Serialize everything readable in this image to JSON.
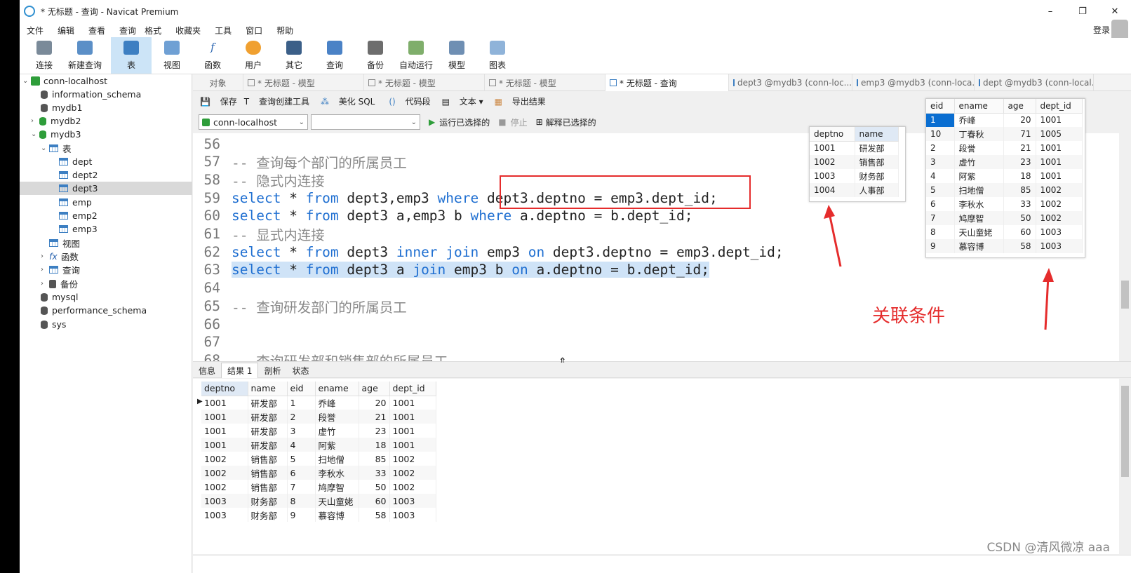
{
  "window": {
    "title": "* 无标题 - 查询 - Navicat Premium",
    "controls": [
      "–",
      "❐",
      "✕"
    ]
  },
  "menu": [
    "文件",
    "编辑",
    "查看",
    "查询",
    "格式",
    "收藏夹",
    "工具",
    "窗口",
    "帮助"
  ],
  "login_label": "登录",
  "toolbar": [
    {
      "label": "连接",
      "icon": "plug-icon"
    },
    {
      "label": "新建查询",
      "icon": "new-query-icon"
    },
    {
      "label": "表",
      "icon": "table-icon"
    },
    {
      "label": "视图",
      "icon": "view-icon"
    },
    {
      "label": "函数",
      "icon": "function-icon"
    },
    {
      "label": "用户",
      "icon": "user-icon"
    },
    {
      "label": "其它",
      "icon": "tools-icon"
    },
    {
      "label": "查询",
      "icon": "query-icon"
    },
    {
      "label": "备份",
      "icon": "backup-icon"
    },
    {
      "label": "自动运行",
      "icon": "schedule-icon"
    },
    {
      "label": "模型",
      "icon": "model-icon"
    },
    {
      "label": "图表",
      "icon": "chart-icon"
    }
  ],
  "tree": {
    "connection": "conn-localhost",
    "databases_top": [
      "information_schema",
      "mydb1",
      "mydb2",
      "mydb3"
    ],
    "tables_label": "表",
    "tables": [
      "dept",
      "dept2",
      "dept3",
      "emp",
      "emp2",
      "emp3"
    ],
    "views_label": "视图",
    "functions_label": "函数",
    "queries_label": "查询",
    "backups_label": "备份",
    "databases_bottom": [
      "mysql",
      "performance_schema",
      "sys"
    ]
  },
  "tabs": [
    "对象",
    "* 无标题 - 模型",
    "* 无标题 - 模型",
    "* 无标题 - 模型",
    "* 无标题 - 查询",
    "dept3 @mydb3 (conn-loc...",
    "emp3 @mydb3 (conn-loca...",
    "dept @mydb3 (conn-local..."
  ],
  "editor_toolbar": {
    "save": "保存",
    "query_builder": "查询创建工具",
    "beautify": "美化 SQL",
    "snippet": "代码段",
    "text": "文本",
    "export": "导出结果",
    "connection": "conn-localhost",
    "run_selected": "运行已选择的",
    "stop": "停止",
    "explain": "解释已选择的"
  },
  "code_lines": [
    {
      "n": "56",
      "parts": []
    },
    {
      "n": "57",
      "parts": [
        [
          "cm",
          "-- 查询每个部门的所属员工"
        ]
      ]
    },
    {
      "n": "58",
      "parts": [
        [
          "cm",
          "-- 隐式内连接"
        ]
      ]
    },
    {
      "n": "59",
      "parts": [
        [
          "kw",
          "select"
        ],
        [
          "t",
          " * "
        ],
        [
          "kw",
          "from"
        ],
        [
          "t",
          " dept3,emp3 "
        ],
        [
          "kw",
          "where"
        ],
        [
          "t",
          " dept3.deptno = emp3.dept_id;"
        ]
      ]
    },
    {
      "n": "60",
      "parts": [
        [
          "kw",
          "select"
        ],
        [
          "t",
          " * "
        ],
        [
          "kw",
          "from"
        ],
        [
          "t",
          " dept3 a,emp3 b "
        ],
        [
          "kw",
          "where"
        ],
        [
          "t",
          " a.deptno = b.dept_id;"
        ]
      ]
    },
    {
      "n": "61",
      "parts": [
        [
          "cm",
          "-- 显式内连接"
        ]
      ]
    },
    {
      "n": "62",
      "parts": [
        [
          "kw",
          "select"
        ],
        [
          "t",
          " * "
        ],
        [
          "kw",
          "from"
        ],
        [
          "t",
          " dept3 "
        ],
        [
          "kw",
          "inner join"
        ],
        [
          "t",
          " emp3 "
        ],
        [
          "kw",
          "on"
        ],
        [
          "t",
          " dept3.deptno = emp3.dept_id;"
        ]
      ]
    },
    {
      "n": "63",
      "parts": [
        [
          "kw",
          "select"
        ],
        [
          "t",
          " * "
        ],
        [
          "kw",
          "from"
        ],
        [
          "t",
          " dept3 a "
        ],
        [
          "kw",
          "join"
        ],
        [
          "t",
          " emp3 b "
        ],
        [
          "kw",
          "on"
        ],
        [
          "t",
          " a.deptno = b.dept_id;"
        ]
      ],
      "selected": true
    },
    {
      "n": "64",
      "parts": []
    },
    {
      "n": "65",
      "parts": [
        [
          "cm",
          "-- 查询研发部门的所属员工"
        ]
      ]
    },
    {
      "n": "66",
      "parts": []
    },
    {
      "n": "67",
      "parts": []
    },
    {
      "n": "68",
      "parts": [
        [
          "cm",
          "-- 查询研发部和销售部的所属员工"
        ]
      ]
    }
  ],
  "dept_table": {
    "headers": [
      "deptno",
      "name"
    ],
    "rows": [
      [
        "1001",
        "研发部"
      ],
      [
        "1002",
        "销售部"
      ],
      [
        "1003",
        "财务部"
      ],
      [
        "1004",
        "人事部"
      ]
    ]
  },
  "emp_table": {
    "headers": [
      "eid",
      "ename",
      "age",
      "dept_id"
    ],
    "rows": [
      [
        "1",
        "乔峰",
        "20",
        "1001"
      ],
      [
        "10",
        "丁春秋",
        "71",
        "1005"
      ],
      [
        "2",
        "段誉",
        "21",
        "1001"
      ],
      [
        "3",
        "虚竹",
        "23",
        "1001"
      ],
      [
        "4",
        "阿紫",
        "18",
        "1001"
      ],
      [
        "5",
        "扫地僧",
        "85",
        "1002"
      ],
      [
        "6",
        "李秋水",
        "33",
        "1002"
      ],
      [
        "7",
        "鸠摩智",
        "50",
        "1002"
      ],
      [
        "8",
        "天山童姥",
        "60",
        "1003"
      ],
      [
        "9",
        "慕容博",
        "58",
        "1003"
      ]
    ]
  },
  "annotation": "关联条件",
  "result_tabs": [
    "信息",
    "结果 1",
    "剖析",
    "状态"
  ],
  "result_table": {
    "headers": [
      "deptno",
      "name",
      "eid",
      "ename",
      "age",
      "dept_id"
    ],
    "rows": [
      [
        "1001",
        "研发部",
        "1",
        "乔峰",
        "20",
        "1001"
      ],
      [
        "1001",
        "研发部",
        "2",
        "段誉",
        "21",
        "1001"
      ],
      [
        "1001",
        "研发部",
        "3",
        "虚竹",
        "23",
        "1001"
      ],
      [
        "1001",
        "研发部",
        "4",
        "阿紫",
        "18",
        "1001"
      ],
      [
        "1002",
        "销售部",
        "5",
        "扫地僧",
        "85",
        "1002"
      ],
      [
        "1002",
        "销售部",
        "6",
        "李秋水",
        "33",
        "1002"
      ],
      [
        "1002",
        "销售部",
        "7",
        "鸠摩智",
        "50",
        "1002"
      ],
      [
        "1003",
        "财务部",
        "8",
        "天山童姥",
        "60",
        "1003"
      ],
      [
        "1003",
        "财务部",
        "9",
        "慕容博",
        "58",
        "1003"
      ]
    ]
  },
  "watermark": "CSDN @清风微凉 aaa",
  "colors": {
    "accent": "#cce4f7",
    "keyword": "#1f6fd1",
    "annotation_red": "#e52c2c",
    "selection": "#cfe3f7"
  }
}
